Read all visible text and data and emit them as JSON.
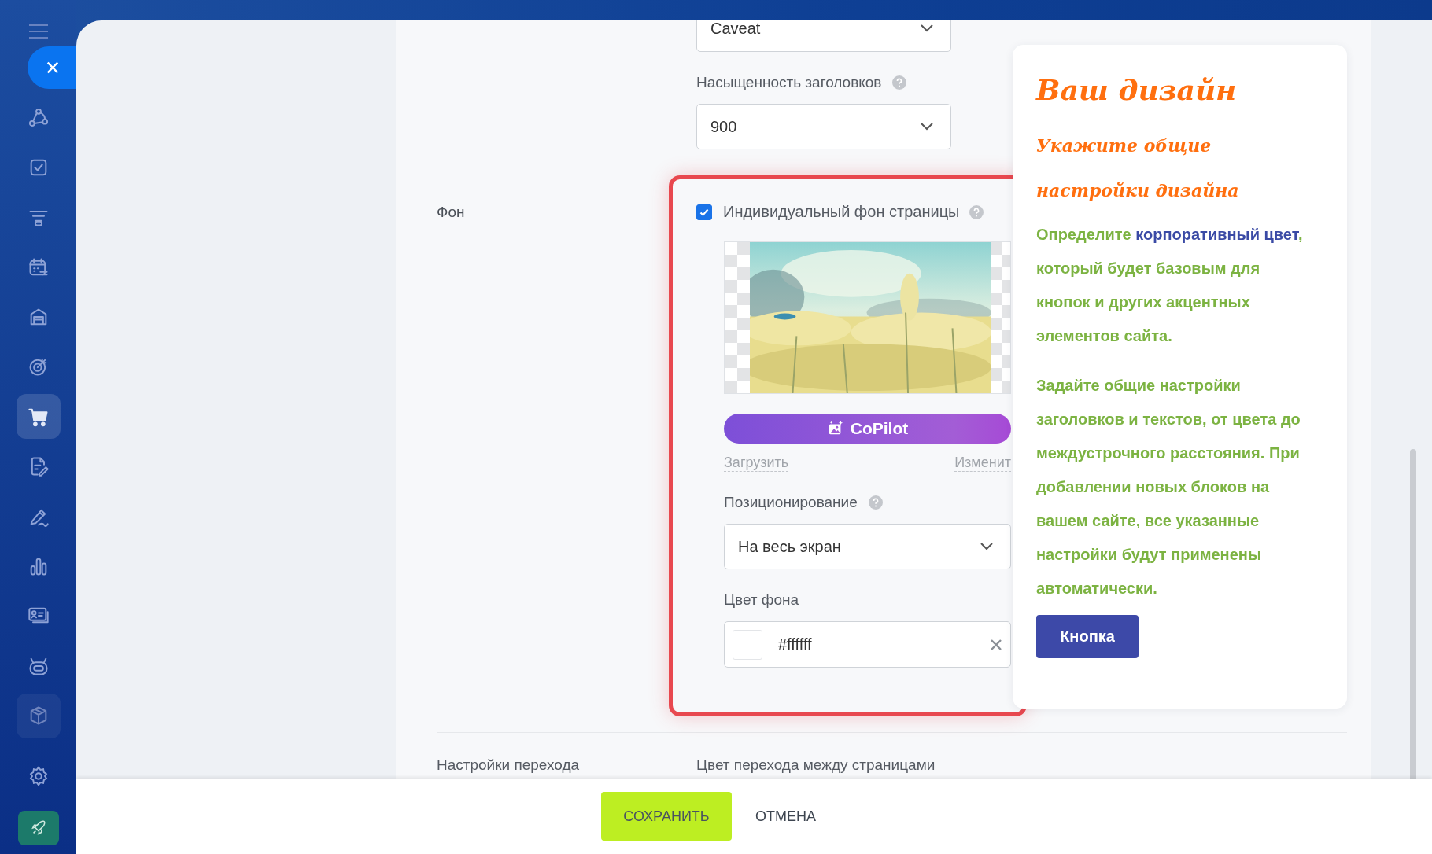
{
  "sidebar": {
    "items": [
      {
        "kind": "routes",
        "selected": false
      },
      {
        "kind": "task",
        "selected": false
      },
      {
        "kind": "funnel",
        "selected": false
      },
      {
        "kind": "calendar",
        "selected": false
      },
      {
        "kind": "garage",
        "selected": false
      },
      {
        "kind": "target",
        "selected": false
      },
      {
        "kind": "cart",
        "selected": true
      },
      {
        "kind": "document",
        "selected": false
      },
      {
        "kind": "pen",
        "selected": false
      },
      {
        "kind": "chart",
        "selected": false
      },
      {
        "kind": "card",
        "selected": false
      },
      {
        "kind": "robot",
        "selected": false
      },
      {
        "kind": "cube",
        "selected": false
      }
    ]
  },
  "form": {
    "font_select": {
      "value": "Caveat"
    },
    "heading_weight": {
      "label": "Насыщенность заголовков",
      "value": "900"
    },
    "background": {
      "label": "Фон",
      "custom_bg": {
        "label": "Индивидуальный фон страницы",
        "checked": true
      },
      "copilot_button": "CoPilot",
      "upload_link": "Загрузить",
      "change_link": "Изменит",
      "positioning": {
        "label": "Позиционирование",
        "value": "На весь экран"
      },
      "bg_color": {
        "label": "Цвет фона",
        "value": "#ffffff"
      }
    },
    "transition": {
      "label": "Настройки перехода",
      "field_label": "Цвет перехода между страницами"
    }
  },
  "preview": {
    "title": "Ваш дизайн",
    "subtitle": "Укажите общие настройки дизайна",
    "paragraph_1": {
      "before": "Определите ",
      "link": "корпоративный цвет",
      "after": ", который будет базовым для кнопок и других акцентных элементов сайта."
    },
    "paragraph_2": "Задайте общие настройки заголовков и текстов, от цвета до междустрочного расстояния. При добавлении новых блоков на вашем сайте, все указанные настройки будут применены автоматически.",
    "button": "Кнопка"
  },
  "footer": {
    "save": "СОХРАНИТЬ",
    "cancel": "ОТМЕНА"
  }
}
